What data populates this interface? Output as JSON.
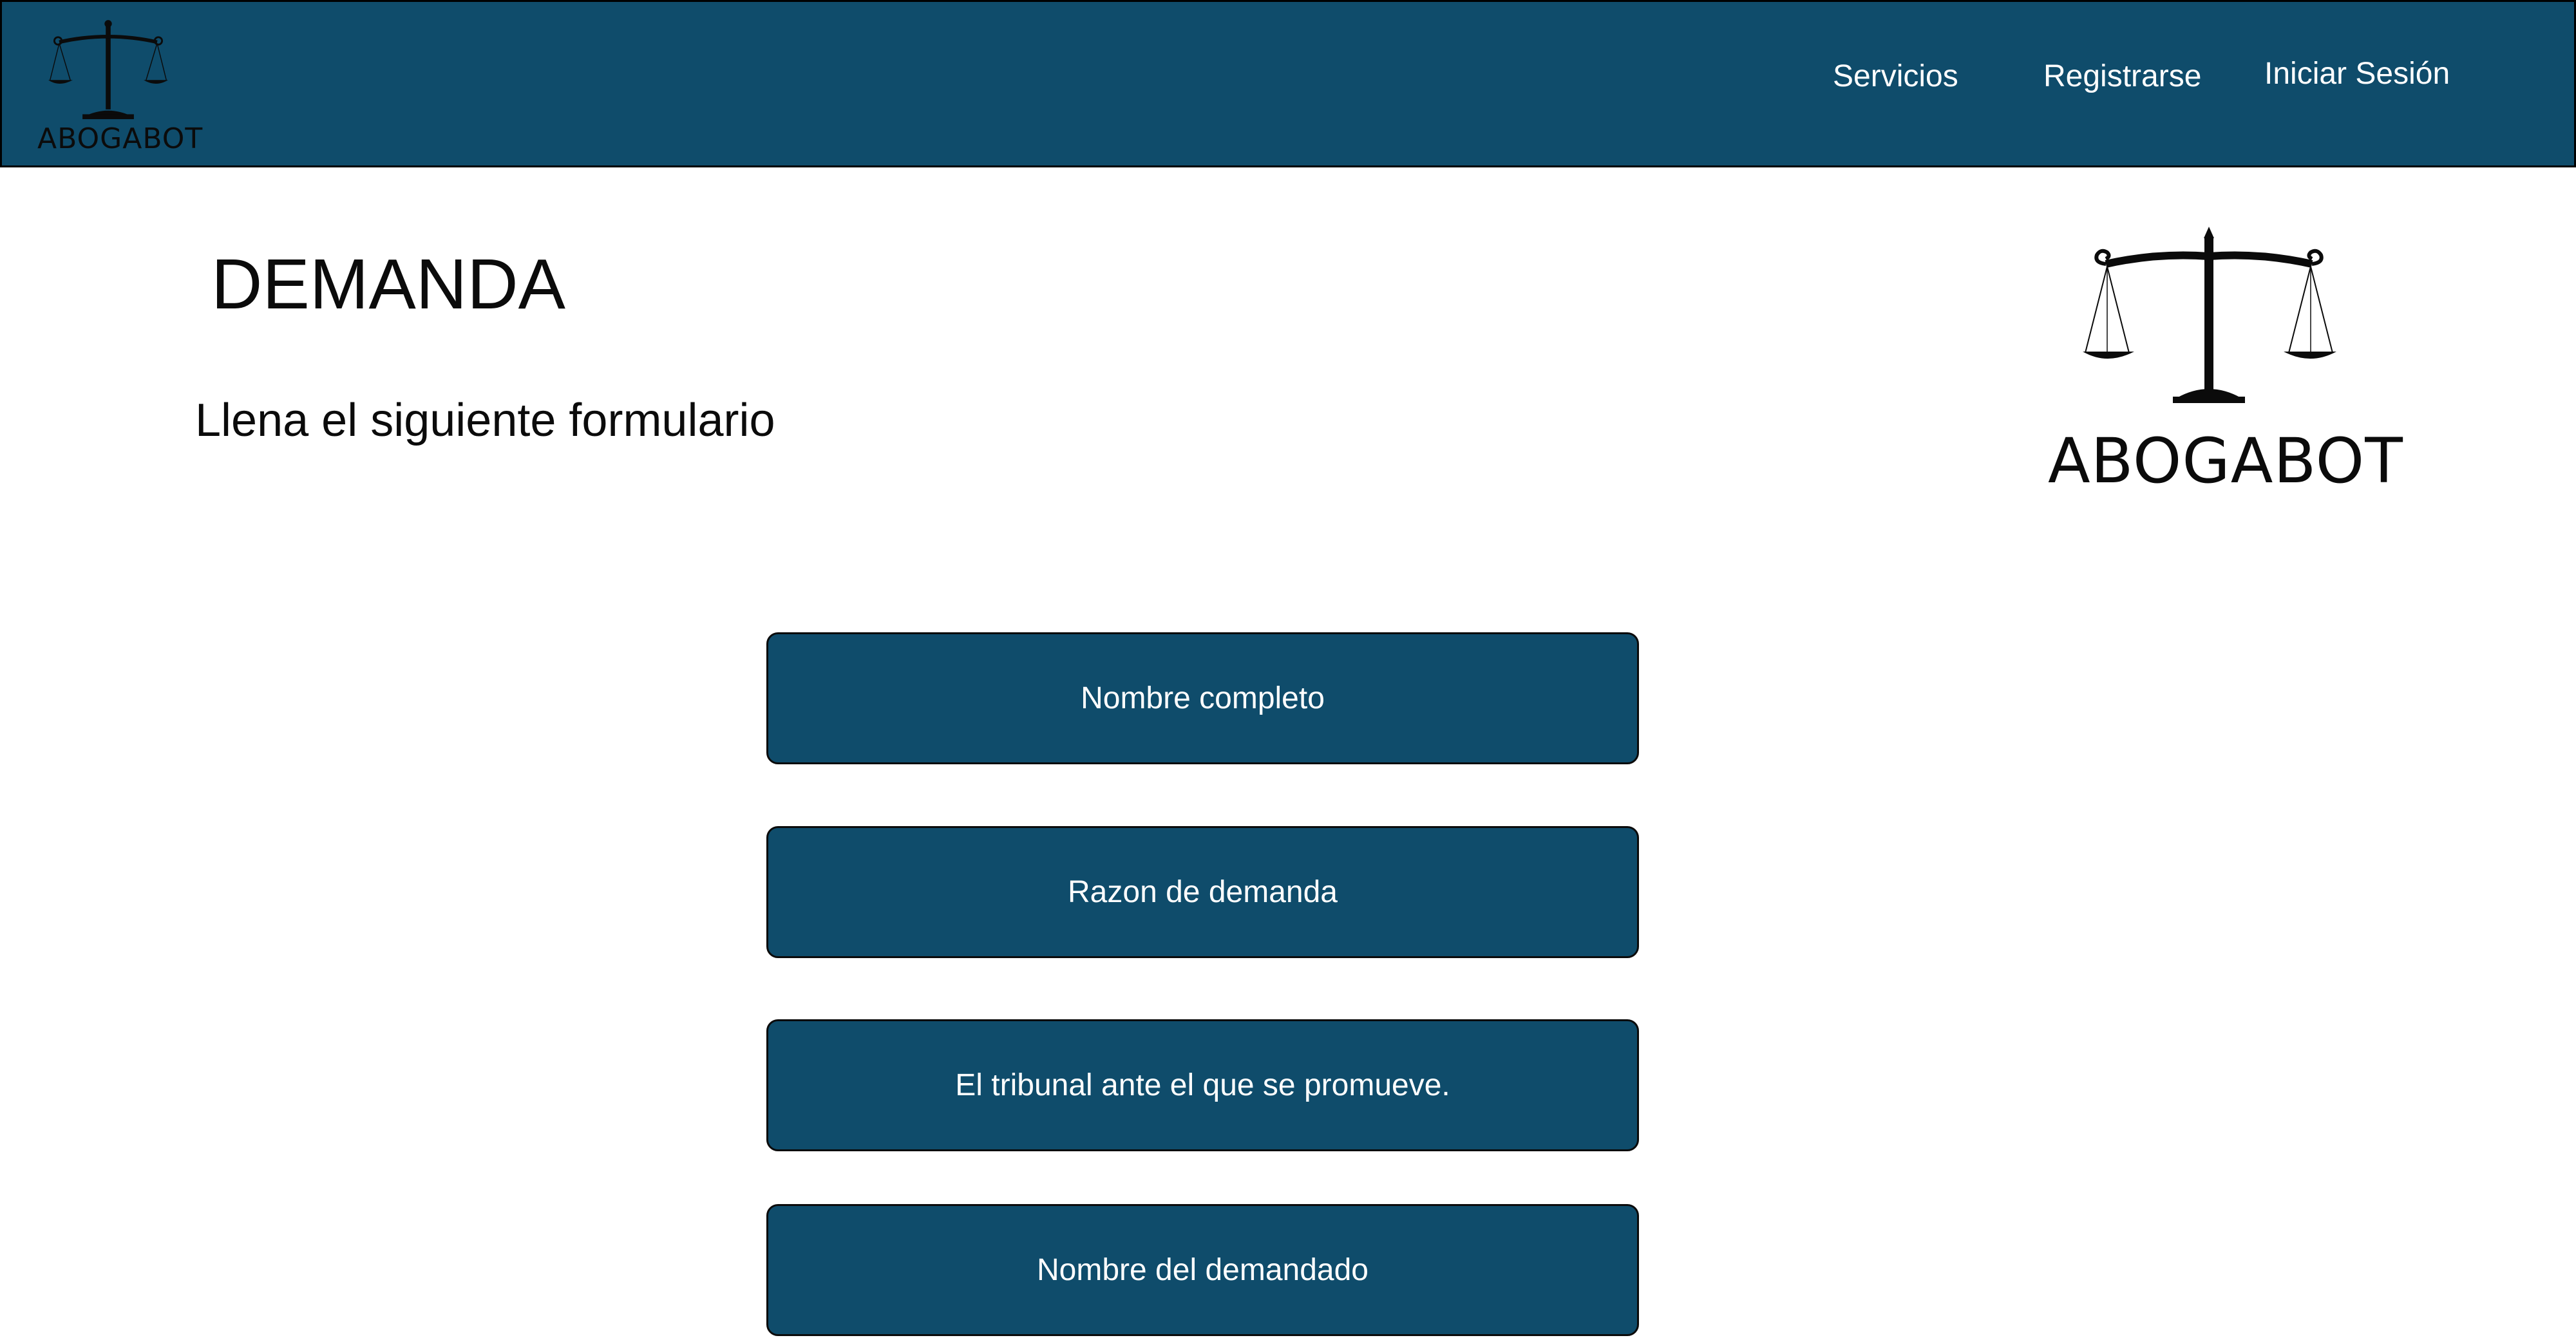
{
  "header": {
    "logo_text": "ABOGABOT",
    "nav": {
      "servicios": "Servicios",
      "registrarse": "Registrarse",
      "iniciar_sesion": "Iniciar Sesión"
    }
  },
  "main": {
    "title": "DEMANDA",
    "subtitle": "Llena el siguiente formulario",
    "brand_text": "ABOGABOT",
    "fields": [
      {
        "label": "Nombre completo"
      },
      {
        "label": "Razon de demanda"
      },
      {
        "label": "El tribunal ante el que se promueve."
      },
      {
        "label": "Nombre del demandado"
      }
    ]
  },
  "colors": {
    "primary": "#0f4c6b",
    "text": "#0b0b0b",
    "background": "#ffffff"
  },
  "icons": {
    "logo": "scales-of-justice-icon"
  }
}
